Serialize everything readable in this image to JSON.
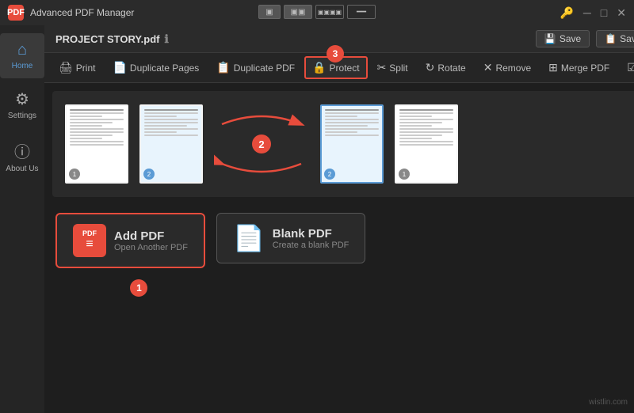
{
  "titlebar": {
    "app_name": "Advanced PDF Manager",
    "icon_label": "PDF",
    "window_controls": [
      "minimize",
      "maximize",
      "close"
    ],
    "lock_icon": "🔑"
  },
  "view_switcher": {
    "options": [
      "single",
      "double",
      "quad",
      "wide"
    ]
  },
  "sidebar": {
    "items": [
      {
        "id": "home",
        "label": "Home",
        "icon": "⌂",
        "active": true
      },
      {
        "id": "settings",
        "label": "Settings",
        "icon": "⚙"
      },
      {
        "id": "about",
        "label": "About Us",
        "icon": "ⓘ"
      }
    ]
  },
  "file_header": {
    "filename": "PROJECT STORY.pdf",
    "save_label": "Save",
    "save_as_label": "Save As"
  },
  "toolbar": {
    "buttons": [
      {
        "id": "print",
        "label": "Print",
        "icon": "🖨"
      },
      {
        "id": "duplicate-pages",
        "label": "Duplicate Pages",
        "icon": "📄",
        "highlighted": false
      },
      {
        "id": "duplicate-pdf",
        "label": "Duplicate PDF",
        "icon": "📋"
      },
      {
        "id": "protect",
        "label": "Protect",
        "icon": "🔒",
        "highlighted": true
      },
      {
        "id": "split",
        "label": "Split",
        "icon": "✂"
      },
      {
        "id": "rotate",
        "label": "Rotate",
        "icon": "↻"
      },
      {
        "id": "remove",
        "label": "Remove",
        "icon": "✕"
      },
      {
        "id": "merge-pdf",
        "label": "Merge PDF",
        "icon": "⊞"
      },
      {
        "id": "select-all",
        "label": "Select All",
        "icon": "☑"
      }
    ]
  },
  "pages": [
    {
      "id": 1,
      "badge": "1",
      "selected": false,
      "badge_color": "dark"
    },
    {
      "id": 2,
      "badge": "2",
      "selected": false,
      "badge_color": "blue"
    },
    {
      "id": 3,
      "badge": "2",
      "selected": true,
      "badge_color": "blue"
    },
    {
      "id": 4,
      "badge": "1",
      "selected": false,
      "badge_color": "dark"
    }
  ],
  "step_badges": {
    "step1_label": "1",
    "step2_label": "2",
    "step3_label": "3"
  },
  "actions": {
    "add_pdf": {
      "title": "Add PDF",
      "subtitle": "Open Another PDF",
      "icon": "PDF"
    },
    "blank_pdf": {
      "title": "Blank PDF",
      "subtitle": "Create a blank PDF",
      "icon": "📄"
    }
  },
  "watermark": "wistlin.com"
}
